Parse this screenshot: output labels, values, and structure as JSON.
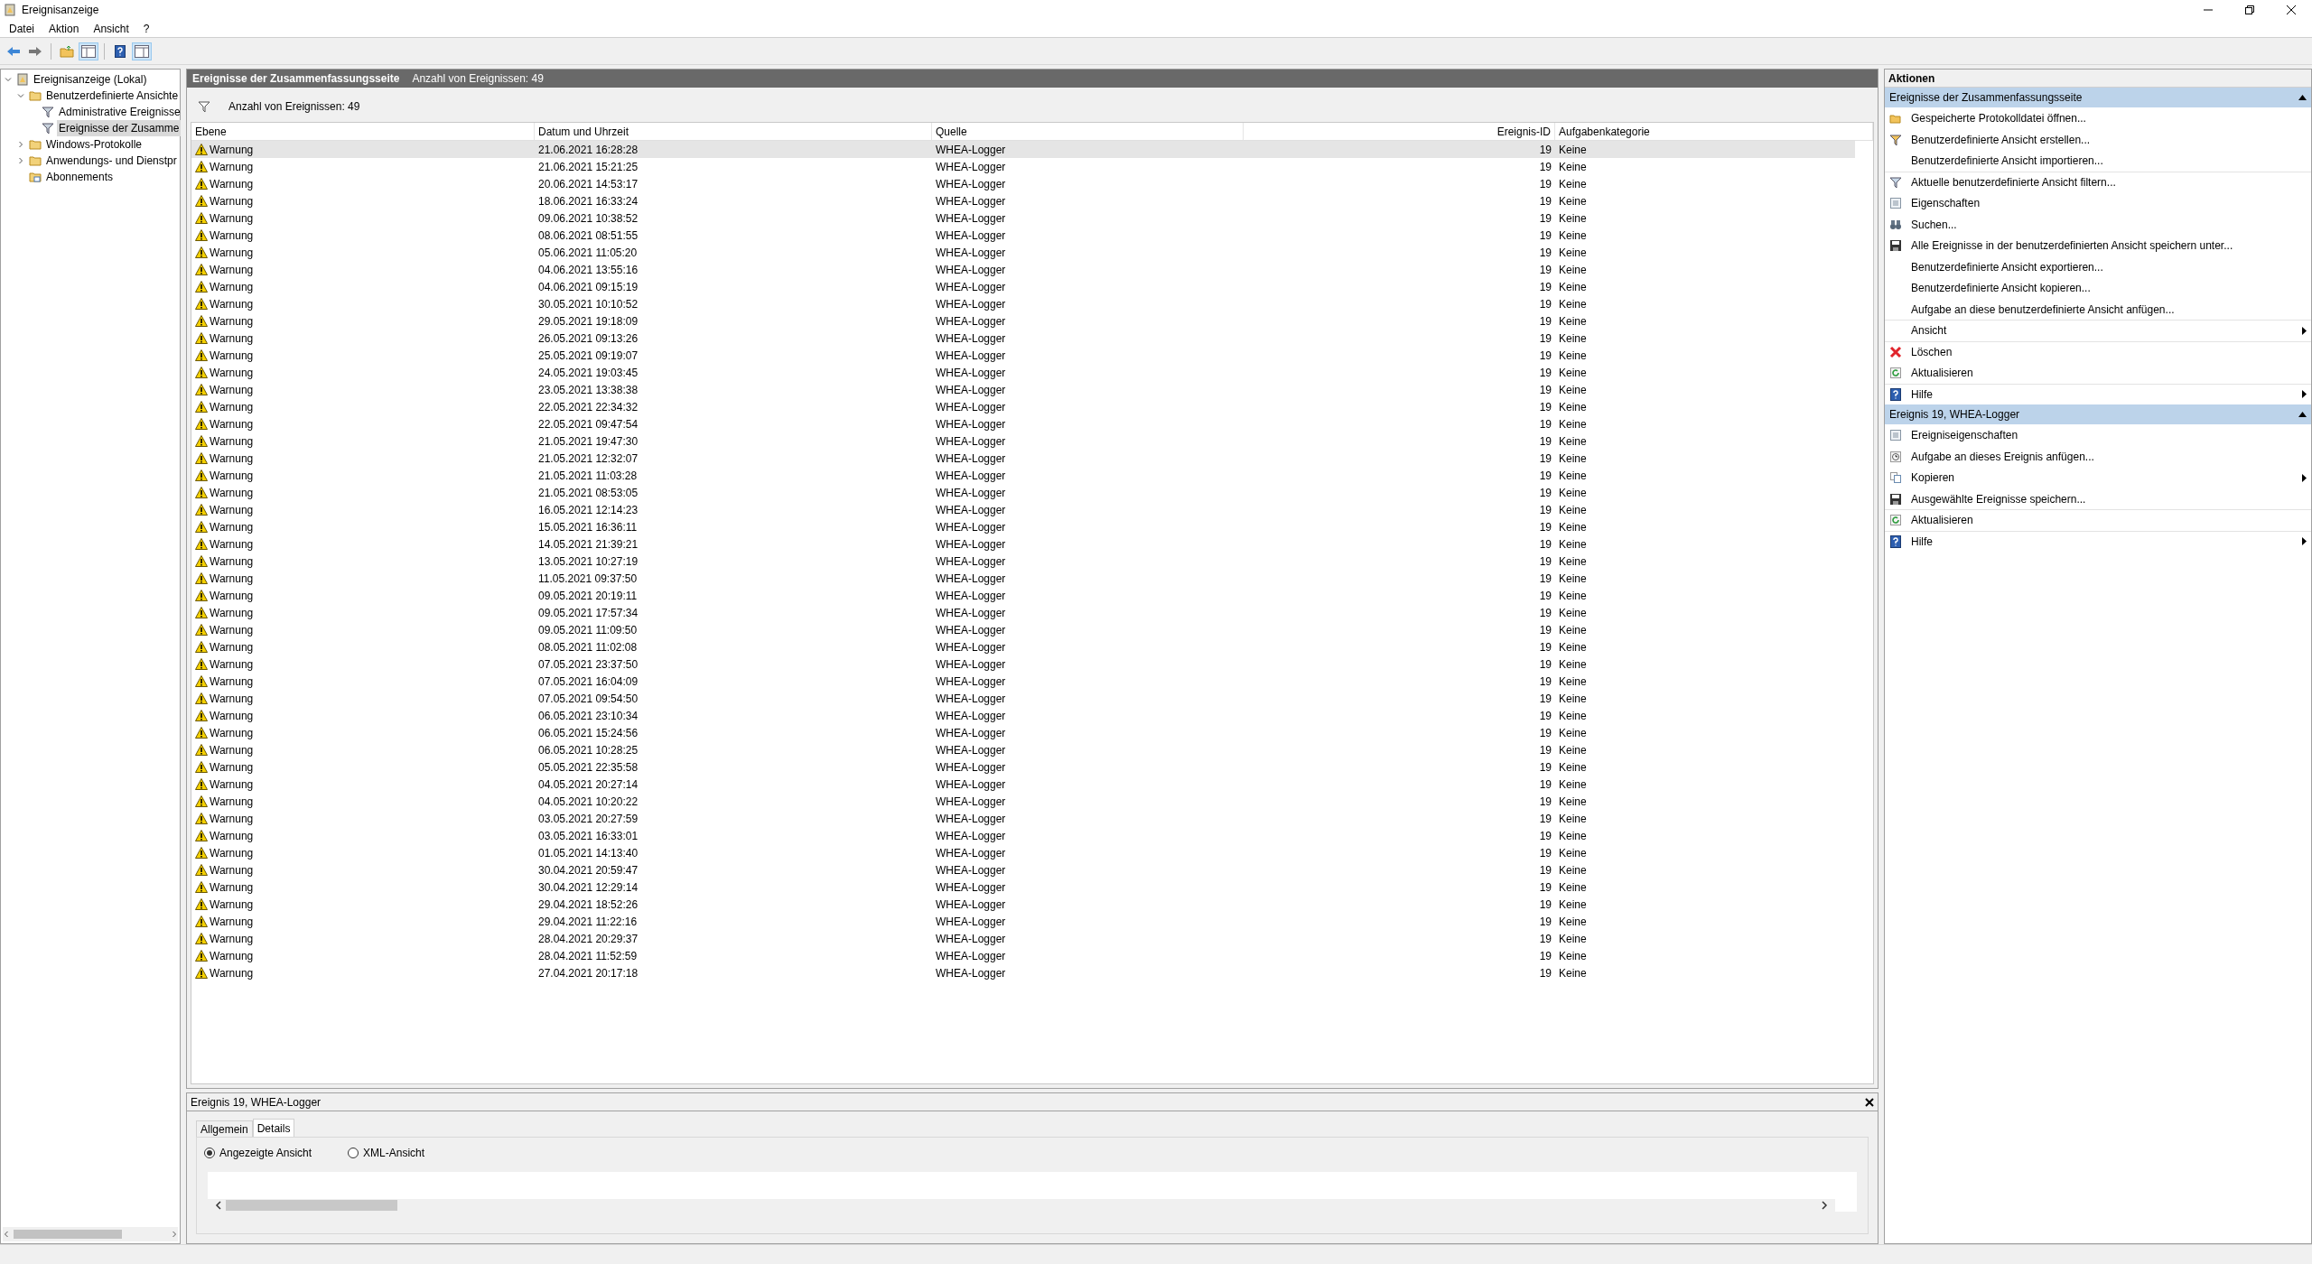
{
  "window": {
    "title": "Ereignisanzeige"
  },
  "menu": [
    "Datei",
    "Aktion",
    "Ansicht",
    "?"
  ],
  "tree": [
    {
      "label": "Ereignisanzeige (Lokal)",
      "kind": "root",
      "selected": false,
      "expanded": true,
      "children": [
        {
          "label": "Benutzerdefinierte Ansichte",
          "kind": "folder",
          "selected": false,
          "expanded": true,
          "children": [
            {
              "label": "Administrative Ereignisse",
              "kind": "filter",
              "selected": false
            },
            {
              "label": "Ereignisse der Zusamme",
              "kind": "filter",
              "selected": true
            }
          ]
        },
        {
          "label": "Windows-Protokolle",
          "kind": "folder",
          "selected": false,
          "expanded": false
        },
        {
          "label": "Anwendungs- und Dienstpr",
          "kind": "folder",
          "selected": false,
          "expanded": false
        },
        {
          "label": "Abonnements",
          "kind": "subscription",
          "selected": false
        }
      ]
    }
  ],
  "center": {
    "title": "Ereignisse der Zusammenfassungsseite",
    "count": "Anzahl von Ereignissen: 49",
    "filter_text": "Anzahl von Ereignissen: 49",
    "columns": [
      "Ebene",
      "Datum und Uhrzeit",
      "Quelle",
      "Ereignis-ID",
      "Aufgabenkategorie"
    ],
    "rows": [
      {
        "level": "Warnung",
        "date": "21.06.2021 16:28:28",
        "source": "WHEA-Logger",
        "id": "19",
        "category": "Keine",
        "selected": true
      },
      {
        "level": "Warnung",
        "date": "21.06.2021 15:21:25",
        "source": "WHEA-Logger",
        "id": "19",
        "category": "Keine",
        "selected": false
      },
      {
        "level": "Warnung",
        "date": "20.06.2021 14:53:17",
        "source": "WHEA-Logger",
        "id": "19",
        "category": "Keine",
        "selected": false
      },
      {
        "level": "Warnung",
        "date": "18.06.2021 16:33:24",
        "source": "WHEA-Logger",
        "id": "19",
        "category": "Keine",
        "selected": false
      },
      {
        "level": "Warnung",
        "date": "09.06.2021 10:38:52",
        "source": "WHEA-Logger",
        "id": "19",
        "category": "Keine",
        "selected": false
      },
      {
        "level": "Warnung",
        "date": "08.06.2021 08:51:55",
        "source": "WHEA-Logger",
        "id": "19",
        "category": "Keine",
        "selected": false
      },
      {
        "level": "Warnung",
        "date": "05.06.2021 11:05:20",
        "source": "WHEA-Logger",
        "id": "19",
        "category": "Keine",
        "selected": false
      },
      {
        "level": "Warnung",
        "date": "04.06.2021 13:55:16",
        "source": "WHEA-Logger",
        "id": "19",
        "category": "Keine",
        "selected": false
      },
      {
        "level": "Warnung",
        "date": "04.06.2021 09:15:19",
        "source": "WHEA-Logger",
        "id": "19",
        "category": "Keine",
        "selected": false
      },
      {
        "level": "Warnung",
        "date": "30.05.2021 10:10:52",
        "source": "WHEA-Logger",
        "id": "19",
        "category": "Keine",
        "selected": false
      },
      {
        "level": "Warnung",
        "date": "29.05.2021 19:18:09",
        "source": "WHEA-Logger",
        "id": "19",
        "category": "Keine",
        "selected": false
      },
      {
        "level": "Warnung",
        "date": "26.05.2021 09:13:26",
        "source": "WHEA-Logger",
        "id": "19",
        "category": "Keine",
        "selected": false
      },
      {
        "level": "Warnung",
        "date": "25.05.2021 09:19:07",
        "source": "WHEA-Logger",
        "id": "19",
        "category": "Keine",
        "selected": false
      },
      {
        "level": "Warnung",
        "date": "24.05.2021 19:03:45",
        "source": "WHEA-Logger",
        "id": "19",
        "category": "Keine",
        "selected": false
      },
      {
        "level": "Warnung",
        "date": "23.05.2021 13:38:38",
        "source": "WHEA-Logger",
        "id": "19",
        "category": "Keine",
        "selected": false
      },
      {
        "level": "Warnung",
        "date": "22.05.2021 22:34:32",
        "source": "WHEA-Logger",
        "id": "19",
        "category": "Keine",
        "selected": false
      },
      {
        "level": "Warnung",
        "date": "22.05.2021 09:47:54",
        "source": "WHEA-Logger",
        "id": "19",
        "category": "Keine",
        "selected": false
      },
      {
        "level": "Warnung",
        "date": "21.05.2021 19:47:30",
        "source": "WHEA-Logger",
        "id": "19",
        "category": "Keine",
        "selected": false
      },
      {
        "level": "Warnung",
        "date": "21.05.2021 12:32:07",
        "source": "WHEA-Logger",
        "id": "19",
        "category": "Keine",
        "selected": false
      },
      {
        "level": "Warnung",
        "date": "21.05.2021 11:03:28",
        "source": "WHEA-Logger",
        "id": "19",
        "category": "Keine",
        "selected": false
      },
      {
        "level": "Warnung",
        "date": "21.05.2021 08:53:05",
        "source": "WHEA-Logger",
        "id": "19",
        "category": "Keine",
        "selected": false
      },
      {
        "level": "Warnung",
        "date": "16.05.2021 12:14:23",
        "source": "WHEA-Logger",
        "id": "19",
        "category": "Keine",
        "selected": false
      },
      {
        "level": "Warnung",
        "date": "15.05.2021 16:36:11",
        "source": "WHEA-Logger",
        "id": "19",
        "category": "Keine",
        "selected": false
      },
      {
        "level": "Warnung",
        "date": "14.05.2021 21:39:21",
        "source": "WHEA-Logger",
        "id": "19",
        "category": "Keine",
        "selected": false
      },
      {
        "level": "Warnung",
        "date": "13.05.2021 10:27:19",
        "source": "WHEA-Logger",
        "id": "19",
        "category": "Keine",
        "selected": false
      },
      {
        "level": "Warnung",
        "date": "11.05.2021 09:37:50",
        "source": "WHEA-Logger",
        "id": "19",
        "category": "Keine",
        "selected": false
      },
      {
        "level": "Warnung",
        "date": "09.05.2021 20:19:11",
        "source": "WHEA-Logger",
        "id": "19",
        "category": "Keine",
        "selected": false
      },
      {
        "level": "Warnung",
        "date": "09.05.2021 17:57:34",
        "source": "WHEA-Logger",
        "id": "19",
        "category": "Keine",
        "selected": false
      },
      {
        "level": "Warnung",
        "date": "09.05.2021 11:09:50",
        "source": "WHEA-Logger",
        "id": "19",
        "category": "Keine",
        "selected": false
      },
      {
        "level": "Warnung",
        "date": "08.05.2021 11:02:08",
        "source": "WHEA-Logger",
        "id": "19",
        "category": "Keine",
        "selected": false
      },
      {
        "level": "Warnung",
        "date": "07.05.2021 23:37:50",
        "source": "WHEA-Logger",
        "id": "19",
        "category": "Keine",
        "selected": false
      },
      {
        "level": "Warnung",
        "date": "07.05.2021 16:04:09",
        "source": "WHEA-Logger",
        "id": "19",
        "category": "Keine",
        "selected": false
      },
      {
        "level": "Warnung",
        "date": "07.05.2021 09:54:50",
        "source": "WHEA-Logger",
        "id": "19",
        "category": "Keine",
        "selected": false
      },
      {
        "level": "Warnung",
        "date": "06.05.2021 23:10:34",
        "source": "WHEA-Logger",
        "id": "19",
        "category": "Keine",
        "selected": false
      },
      {
        "level": "Warnung",
        "date": "06.05.2021 15:24:56",
        "source": "WHEA-Logger",
        "id": "19",
        "category": "Keine",
        "selected": false
      },
      {
        "level": "Warnung",
        "date": "06.05.2021 10:28:25",
        "source": "WHEA-Logger",
        "id": "19",
        "category": "Keine",
        "selected": false
      },
      {
        "level": "Warnung",
        "date": "05.05.2021 22:35:58",
        "source": "WHEA-Logger",
        "id": "19",
        "category": "Keine",
        "selected": false
      },
      {
        "level": "Warnung",
        "date": "04.05.2021 20:27:14",
        "source": "WHEA-Logger",
        "id": "19",
        "category": "Keine",
        "selected": false
      },
      {
        "level": "Warnung",
        "date": "04.05.2021 10:20:22",
        "source": "WHEA-Logger",
        "id": "19",
        "category": "Keine",
        "selected": false
      },
      {
        "level": "Warnung",
        "date": "03.05.2021 20:27:59",
        "source": "WHEA-Logger",
        "id": "19",
        "category": "Keine",
        "selected": false
      },
      {
        "level": "Warnung",
        "date": "03.05.2021 16:33:01",
        "source": "WHEA-Logger",
        "id": "19",
        "category": "Keine",
        "selected": false
      },
      {
        "level": "Warnung",
        "date": "01.05.2021 14:13:40",
        "source": "WHEA-Logger",
        "id": "19",
        "category": "Keine",
        "selected": false
      },
      {
        "level": "Warnung",
        "date": "30.04.2021 20:59:47",
        "source": "WHEA-Logger",
        "id": "19",
        "category": "Keine",
        "selected": false
      },
      {
        "level": "Warnung",
        "date": "30.04.2021 12:29:14",
        "source": "WHEA-Logger",
        "id": "19",
        "category": "Keine",
        "selected": false
      },
      {
        "level": "Warnung",
        "date": "29.04.2021 18:52:26",
        "source": "WHEA-Logger",
        "id": "19",
        "category": "Keine",
        "selected": false
      },
      {
        "level": "Warnung",
        "date": "29.04.2021 11:22:16",
        "source": "WHEA-Logger",
        "id": "19",
        "category": "Keine",
        "selected": false
      },
      {
        "level": "Warnung",
        "date": "28.04.2021 20:29:37",
        "source": "WHEA-Logger",
        "id": "19",
        "category": "Keine",
        "selected": false
      },
      {
        "level": "Warnung",
        "date": "28.04.2021 11:52:59",
        "source": "WHEA-Logger",
        "id": "19",
        "category": "Keine",
        "selected": false
      },
      {
        "level": "Warnung",
        "date": "27.04.2021 20:17:18",
        "source": "WHEA-Logger",
        "id": "19",
        "category": "Keine",
        "selected": false
      }
    ]
  },
  "details": {
    "title": "Ereignis 19, WHEA-Logger",
    "tabs": [
      {
        "label": "Allgemein",
        "selected": false
      },
      {
        "label": "Details",
        "selected": true
      }
    ],
    "view_options": [
      {
        "label": "Angezeigte Ansicht",
        "selected": true
      },
      {
        "label": "XML-Ansicht",
        "selected": false
      }
    ]
  },
  "actions": {
    "title": "Aktionen",
    "sections": [
      {
        "title": "Ereignisse der Zusammenfassungsseite",
        "expanded": true,
        "items": [
          {
            "label": "Gespeicherte Protokolldatei öffnen...",
            "kind": "open",
            "submenu": false,
            "separator_before": false
          },
          {
            "label": "Benutzerdefinierte Ansicht erstellen...",
            "kind": "create-filter",
            "submenu": false,
            "separator_before": false
          },
          {
            "label": "Benutzerdefinierte Ansicht importieren...",
            "kind": "none",
            "submenu": false,
            "separator_before": false
          },
          {
            "label": "Aktuelle benutzerdefinierte Ansicht filtern...",
            "kind": "filter",
            "submenu": false,
            "separator_before": true
          },
          {
            "label": "Eigenschaften",
            "kind": "properties",
            "submenu": false,
            "separator_before": false
          },
          {
            "label": "Suchen...",
            "kind": "search",
            "submenu": false,
            "separator_before": false
          },
          {
            "label": "Alle Ereignisse in der benutzerdefinierten Ansicht speichern unter...",
            "kind": "save",
            "submenu": false,
            "separator_before": false
          },
          {
            "label": "Benutzerdefinierte Ansicht exportieren...",
            "kind": "none",
            "submenu": false,
            "separator_before": false
          },
          {
            "label": "Benutzerdefinierte Ansicht kopieren...",
            "kind": "none",
            "submenu": false,
            "separator_before": false
          },
          {
            "label": "Aufgabe an diese benutzerdefinierte Ansicht anfügen...",
            "kind": "none",
            "submenu": false,
            "separator_before": false
          },
          {
            "label": "Ansicht",
            "kind": "none",
            "submenu": true,
            "separator_before": true
          },
          {
            "label": "Löschen",
            "kind": "delete",
            "submenu": false,
            "separator_before": true
          },
          {
            "label": "Aktualisieren",
            "kind": "refresh",
            "submenu": false,
            "separator_before": false
          },
          {
            "label": "Hilfe",
            "kind": "help",
            "submenu": true,
            "separator_before": true
          }
        ]
      },
      {
        "title": "Ereignis 19, WHEA-Logger",
        "expanded": true,
        "items": [
          {
            "label": "Ereigniseigenschaften",
            "kind": "properties",
            "submenu": false,
            "separator_before": false
          },
          {
            "label": "Aufgabe an dieses Ereignis anfügen...",
            "kind": "task",
            "submenu": false,
            "separator_before": false
          },
          {
            "label": "Kopieren",
            "kind": "copy",
            "submenu": true,
            "separator_before": false
          },
          {
            "label": "Ausgewählte Ereignisse speichern...",
            "kind": "save",
            "submenu": false,
            "separator_before": false
          },
          {
            "label": "Aktualisieren",
            "kind": "refresh",
            "submenu": false,
            "separator_before": true
          },
          {
            "label": "Hilfe",
            "kind": "help",
            "submenu": true,
            "separator_before": true
          }
        ]
      }
    ]
  }
}
